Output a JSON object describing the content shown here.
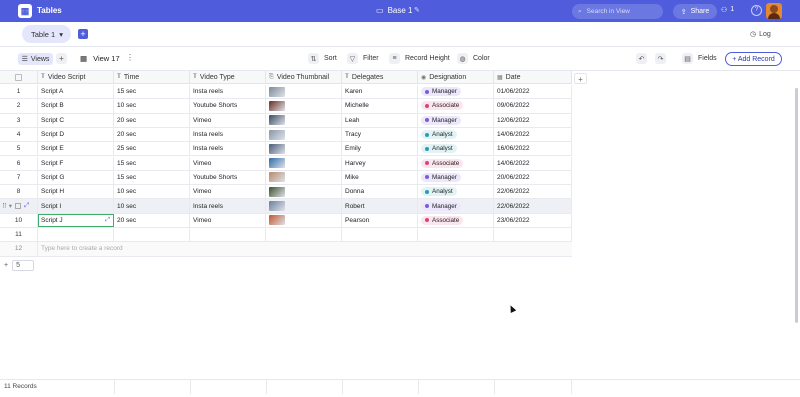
{
  "app": {
    "title": "Tables",
    "logo_glyph": "▦"
  },
  "base": {
    "title": "Base 1",
    "icon": "folder-icon"
  },
  "search": {
    "placeholder": "Search in View"
  },
  "share": {
    "label": "Share"
  },
  "members": {
    "count": "1"
  },
  "help": {
    "glyph": "?"
  },
  "tabs": {
    "active": "Table 1",
    "dropdown_glyph": "▾",
    "add_glyph": "+"
  },
  "log": {
    "label": "Log"
  },
  "toolbar": {
    "views_label": "Views",
    "view_name": "View 17",
    "sort_label": "Sort",
    "filter_label": "Filter",
    "record_height_label": "Record Height",
    "color_label": "Color",
    "fields_label": "Fields",
    "add_record_label": "+ Add Record"
  },
  "columns": [
    {
      "label": "Video Script",
      "icon": "text-icon"
    },
    {
      "label": "Time",
      "icon": "text-icon"
    },
    {
      "label": "Video Type",
      "icon": "text-icon"
    },
    {
      "label": "Video Thumbnail",
      "icon": "attachment-icon"
    },
    {
      "label": "Delegates",
      "icon": "text-icon"
    },
    {
      "label": "Designation",
      "icon": "select-icon"
    },
    {
      "label": "Date",
      "icon": "calendar-icon"
    }
  ],
  "designation_colors": {
    "Manager": {
      "bg": "#ece7fb",
      "dot": "#7a5cd6"
    },
    "Associate": {
      "bg": "#fce6ee",
      "dot": "#d6457a"
    },
    "Analyst": {
      "bg": "#e2f3f6",
      "dot": "#2a9cb4"
    }
  },
  "rows": [
    {
      "n": "1",
      "script": "Script A",
      "time": "15 sec",
      "type": "Insta reels",
      "thumb": "#7d8a96",
      "delegate": "Karen",
      "designation": "Manager",
      "date": "01/06/2022"
    },
    {
      "n": "2",
      "script": "Script B",
      "time": "10 sec",
      "type": "Youtube Shorts",
      "thumb": "#6b2c20",
      "delegate": "Michelle",
      "designation": "Associate",
      "date": "09/06/2022"
    },
    {
      "n": "3",
      "script": "Script C",
      "time": "20 sec",
      "type": "Vimeo",
      "thumb": "#3b4a63",
      "delegate": "Leah",
      "designation": "Manager",
      "date": "12/06/2022"
    },
    {
      "n": "4",
      "script": "Script D",
      "time": "20 sec",
      "type": "Insta reels",
      "thumb": "#8896a8",
      "delegate": "Tracy",
      "designation": "Analyst",
      "date": "14/06/2022"
    },
    {
      "n": "5",
      "script": "Script E",
      "time": "25 sec",
      "type": "Insta reels",
      "thumb": "#4a5a78",
      "delegate": "Emily",
      "designation": "Analyst",
      "date": "16/06/2022"
    },
    {
      "n": "6",
      "script": "Script F",
      "time": "15 sec",
      "type": "Vimeo",
      "thumb": "#2f6aa8",
      "delegate": "Harvey",
      "designation": "Associate",
      "date": "14/06/2022"
    },
    {
      "n": "7",
      "script": "Script G",
      "time": "15 sec",
      "type": "Youtube Shorts",
      "thumb": "#b58a6a",
      "delegate": "Mike",
      "designation": "Manager",
      "date": "20/06/2022"
    },
    {
      "n": "8",
      "script": "Script H",
      "time": "10 sec",
      "type": "Vimeo",
      "thumb": "#3d4f2e",
      "delegate": "Donna",
      "designation": "Analyst",
      "date": "22/06/2022"
    },
    {
      "n": "9",
      "script": "Script I",
      "time": "10 sec",
      "type": "Insta reels",
      "thumb": "#6a7f9c",
      "delegate": "Robert",
      "designation": "Manager",
      "date": "22/06/2022"
    },
    {
      "n": "10",
      "script": "Script J",
      "time": "20 sec",
      "type": "Vimeo",
      "thumb": "#c2552a",
      "delegate": "Pearson",
      "designation": "Associate",
      "date": "23/06/2022"
    },
    {
      "n": "11",
      "script": "",
      "time": "",
      "type": "",
      "thumb": "",
      "delegate": "",
      "designation": "",
      "date": ""
    }
  ],
  "create_row": {
    "n": "12",
    "placeholder": "Type here to create a record"
  },
  "page_size": {
    "value": "5"
  },
  "footer": {
    "records": "11 Records"
  }
}
